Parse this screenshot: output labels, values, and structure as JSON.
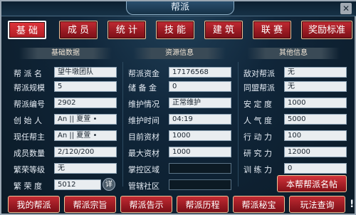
{
  "window": {
    "title": "帮派",
    "close_label": "✕"
  },
  "tabs": [
    {
      "label": "基 础",
      "active": true
    },
    {
      "label": "成 员"
    },
    {
      "label": "统 计"
    },
    {
      "label": "技 能"
    },
    {
      "label": "建 筑"
    },
    {
      "label": "联 赛"
    },
    {
      "label": "奖励标准"
    }
  ],
  "sections": {
    "basic": "基础数据",
    "resource": "资源信息",
    "other": "其他信息"
  },
  "basic": {
    "name": {
      "label": "帮 派 名",
      "value": "望牛墩团队"
    },
    "scale": {
      "label": "帮派规模",
      "value": "5"
    },
    "id": {
      "label": "帮派编号",
      "value": "2902"
    },
    "founder": {
      "label": "创 始 人",
      "value": "An || 夏萱 •"
    },
    "leader": {
      "label": "现任帮主",
      "value": "An || 夏萱 •"
    },
    "members": {
      "label": "成员数量",
      "value": "2/120/200"
    },
    "prosperity_level": {
      "label": "繁荣等级",
      "value": "无"
    },
    "prosperity": {
      "label": "繁 荣 度",
      "value": "5012",
      "detail_label": "详"
    }
  },
  "resource": {
    "funds": {
      "label": "帮派资金",
      "value": "17176568"
    },
    "reserve": {
      "label": "储 备 金",
      "value": "0"
    },
    "maintenance": {
      "label": "维护情况",
      "value": "正常维护"
    },
    "maintenance_time": {
      "label": "维护时间",
      "value": "04:19"
    },
    "current_material": {
      "label": "目前资材",
      "value": "1000"
    },
    "max_material": {
      "label": "最大资材",
      "value": "1000"
    },
    "control_area": {
      "label": "掌控区域",
      "value": ""
    },
    "jurisdiction": {
      "label": "管辖社区",
      "value": ""
    }
  },
  "other": {
    "enemy": {
      "label": "敌对帮派",
      "value": "无"
    },
    "ally": {
      "label": "同盟帮派",
      "value": "无"
    },
    "stability": {
      "label": "安 定 度",
      "value": "1000"
    },
    "popularity": {
      "label": "人 气 度",
      "value": "5000"
    },
    "action": {
      "label": "行 动 力",
      "value": "100"
    },
    "research": {
      "label": "研 究 力",
      "value": "12000"
    },
    "training": {
      "label": "训 练 力",
      "value": "0"
    },
    "rename_button": "本帮帮派名帖"
  },
  "bottom_buttons": [
    "我的帮派",
    "帮派宗旨",
    "帮派告示",
    "帮派历程",
    "帮派秘宝",
    "玩法查询"
  ],
  "alert_icon": "!"
}
